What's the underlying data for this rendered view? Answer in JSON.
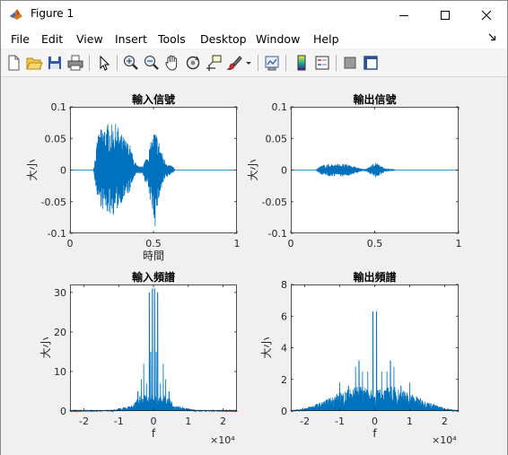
{
  "window": {
    "title": "Figure 1"
  },
  "menu": [
    "File",
    "Edit",
    "View",
    "Insert",
    "Tools",
    "Desktop",
    "Window",
    "Help"
  ],
  "toolbar_icons": [
    "new-figure-icon",
    "open-file-icon",
    "save-icon",
    "print-icon",
    "select-arrow-icon",
    "zoom-in-icon",
    "zoom-out-icon",
    "pan-hand-icon",
    "rotate-3d-icon",
    "data-cursor-icon",
    "brush-icon",
    "brush-dropdown-icon",
    "link-plot-icon",
    "colorbar-icon",
    "legend-icon",
    "hide-plot-tools-icon",
    "show-plot-tools-icon"
  ],
  "colors": {
    "line": "#0072bd",
    "axes": "#262626",
    "background": "#f0f0f0"
  },
  "chart_data": [
    {
      "type": "line",
      "title": "輸入信號",
      "xlabel": "時間",
      "ylabel": "大小",
      "xlim": [
        0,
        1
      ],
      "ylim": [
        -0.1,
        0.1
      ],
      "xticks": [
        "0",
        "0.5",
        "1"
      ],
      "yticks": [
        "0.1",
        "0.05",
        "0",
        "-0.05",
        "-0.1"
      ],
      "exponent": "",
      "envelope": {
        "x": [
          0,
          0.14,
          0.15,
          0.17,
          0.2,
          0.23,
          0.26,
          0.28,
          0.3,
          0.33,
          0.36,
          0.38,
          0.4,
          0.42,
          0.44,
          0.47,
          0.5,
          0.51,
          0.53,
          0.55,
          0.57,
          0.6,
          0.62,
          0.63,
          1.0
        ],
        "upper": [
          0,
          0,
          0.02,
          0.06,
          0.07,
          0.075,
          0.07,
          0.075,
          0.06,
          0.05,
          0.04,
          0.02,
          0.008,
          0.005,
          0.01,
          0.03,
          0.06,
          0.065,
          0.05,
          0.03,
          0.015,
          0.008,
          0.005,
          0,
          0
        ],
        "lower": [
          0,
          0,
          -0.02,
          -0.05,
          -0.065,
          -0.07,
          -0.072,
          -0.065,
          -0.055,
          -0.045,
          -0.035,
          -0.015,
          -0.006,
          -0.005,
          -0.01,
          -0.035,
          -0.075,
          -0.09,
          -0.05,
          -0.03,
          -0.015,
          -0.008,
          -0.004,
          0,
          0
        ]
      }
    },
    {
      "type": "line",
      "title": "輸出信號",
      "xlabel": "",
      "ylabel": "大小",
      "xlim": [
        0,
        1
      ],
      "ylim": [
        -0.1,
        0.1
      ],
      "xticks": [
        "0",
        "0.5",
        "1"
      ],
      "yticks": [
        "0.1",
        "0.05",
        "0",
        "-0.05",
        "-0.1"
      ],
      "exponent": "",
      "envelope": {
        "x": [
          0,
          0.15,
          0.17,
          0.2,
          0.25,
          0.3,
          0.35,
          0.38,
          0.42,
          0.45,
          0.47,
          0.5,
          0.52,
          0.54,
          0.56,
          0.6,
          0.62,
          1.0
        ],
        "upper": [
          0,
          0,
          0.006,
          0.009,
          0.01,
          0.01,
          0.009,
          0.006,
          0.002,
          0.002,
          0.006,
          0.012,
          0.01,
          0.006,
          0.003,
          0.002,
          0,
          0
        ],
        "lower": [
          0,
          0,
          -0.006,
          -0.009,
          -0.01,
          -0.01,
          -0.009,
          -0.006,
          -0.002,
          -0.002,
          -0.006,
          -0.012,
          -0.01,
          -0.006,
          -0.003,
          -0.002,
          0,
          0
        ]
      }
    },
    {
      "type": "line",
      "title": "輸入頻譜",
      "xlabel": "f",
      "ylabel": "大小",
      "xlim": [
        -2.4,
        2.4
      ],
      "ylim": [
        0,
        32
      ],
      "xticks": [
        "-2",
        "-1",
        "0",
        "1",
        "2"
      ],
      "yticks": [
        "30",
        "20",
        "10",
        "0"
      ],
      "exponent": "×10⁴",
      "spikes": {
        "x": [
          -0.45,
          -0.35,
          -0.28,
          -0.2,
          -0.12,
          -0.08,
          -0.03,
          0.03,
          0.08,
          0.12,
          0.2,
          0.28,
          0.35,
          0.45
        ],
        "y": [
          5,
          8,
          12,
          7,
          30,
          15,
          31,
          31,
          15,
          30,
          7,
          12,
          8,
          5
        ]
      },
      "floor": {
        "x": [
          -2.4,
          -1.2,
          -0.6,
          -0.4,
          0.4,
          0.6,
          1.2,
          2.4
        ],
        "y": [
          0.1,
          0.3,
          1.5,
          4,
          4,
          1.5,
          0.3,
          0.1
        ]
      }
    },
    {
      "type": "line",
      "title": "輸出頻譜",
      "xlabel": "f",
      "ylabel": "大小",
      "xlim": [
        -2.4,
        2.4
      ],
      "ylim": [
        0,
        8
      ],
      "xticks": [
        "-2",
        "-1",
        "0",
        "1",
        "2"
      ],
      "yticks": [
        "8",
        "6",
        "4",
        "2",
        "0"
      ],
      "exponent": "×10⁴",
      "spikes": {
        "x": [
          -1.0,
          -0.75,
          -0.55,
          -0.45,
          -0.35,
          -0.2,
          -0.05,
          0.05,
          0.2,
          0.35,
          0.45,
          0.55,
          0.75,
          1.0
        ],
        "y": [
          1.8,
          1.6,
          2.8,
          3.2,
          2.5,
          2.5,
          6.3,
          6.3,
          2.5,
          2.5,
          3.2,
          2.8,
          1.6,
          1.8
        ]
      },
      "floor": {
        "x": [
          -2.4,
          -2.0,
          -1.5,
          -1.0,
          -0.5,
          0,
          0.5,
          1.0,
          1.5,
          2.0,
          2.4
        ],
        "y": [
          0.05,
          0.2,
          0.6,
          1.2,
          1.6,
          1.3,
          1.6,
          1.2,
          0.6,
          0.2,
          0.05
        ]
      }
    }
  ]
}
